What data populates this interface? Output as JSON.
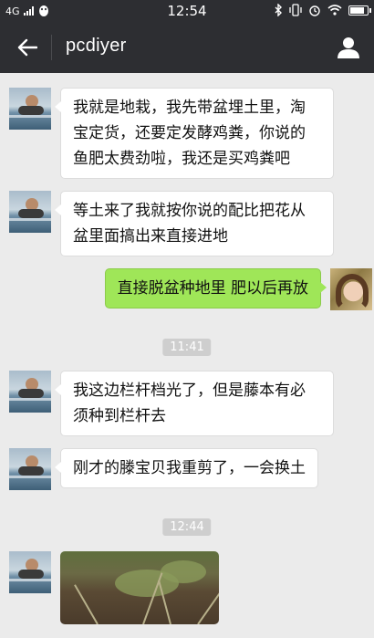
{
  "status_bar": {
    "network": "4G",
    "time": "12:54"
  },
  "header": {
    "title": "pcdiyer"
  },
  "messages": [
    {
      "from": "contact",
      "text_lines": [
        "我就是地栽，我先带盆埋土里，淘",
        "宝定货，还要定发酵鸡粪，你说的",
        "鱼肥太费劲啦，我还是买鸡粪吧"
      ]
    },
    {
      "from": "contact",
      "text_lines": [
        "等土来了我就按你说的配比把花从",
        "盆里面搞出来直接进地"
      ]
    },
    {
      "from": "me",
      "text_lines": [
        "直接脱盆种地里 肥以后再放"
      ]
    },
    {
      "time": "11:41"
    },
    {
      "from": "contact",
      "text_lines": [
        "我这边栏杆档光了，但是藤本有必",
        "须种到栏杆去"
      ]
    },
    {
      "from": "contact",
      "text_lines": [
        "刚才的滕宝贝我重剪了，一会换土"
      ]
    },
    {
      "time": "12:44"
    },
    {
      "from": "contact",
      "type": "image"
    }
  ],
  "icons": {
    "back": "back-arrow-icon",
    "profile": "person-icon",
    "notification": "qq-penguin-icon",
    "bluetooth": "bluetooth-icon",
    "vibrate": "vibrate-icon",
    "alarm": "alarm-icon",
    "wifi": "wifi-icon",
    "battery": "battery-icon"
  },
  "colors": {
    "header_bg": "#2d2e32",
    "chat_bg": "#ebebeb",
    "outgoing_bubble": "#9fe658",
    "incoming_bubble": "#ffffff"
  }
}
